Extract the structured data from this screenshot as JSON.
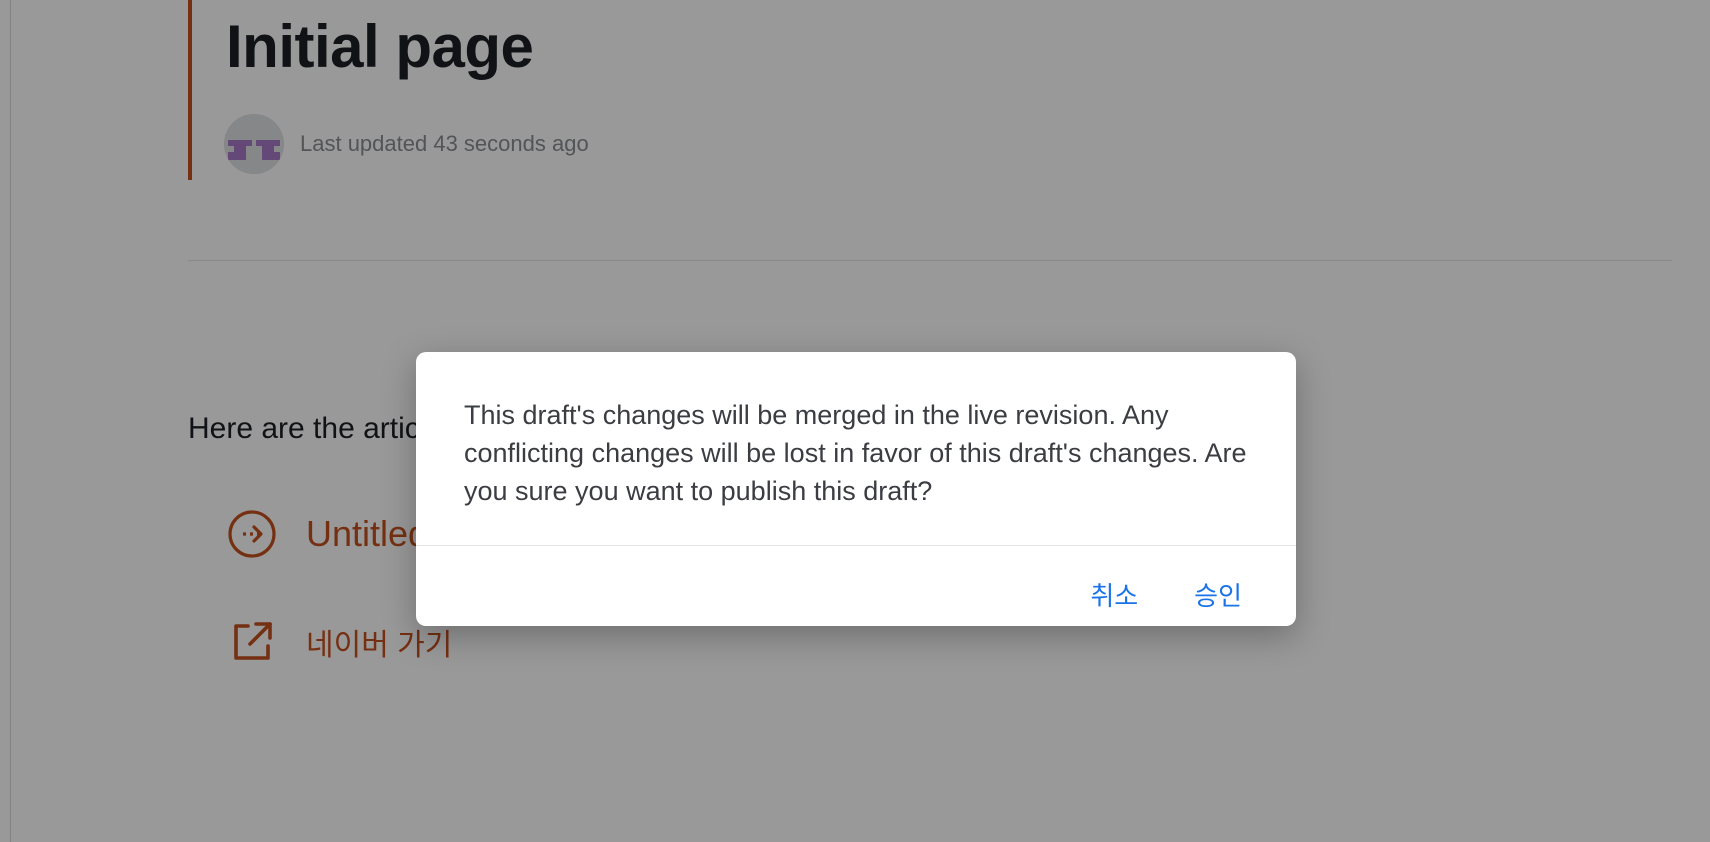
{
  "page": {
    "title": "Initial page",
    "last_updated": "Last updated 43 seconds ago",
    "intro_text": "Here are the articles in this section:",
    "links": [
      {
        "label": "Untitled",
        "icon": "arrow-circle-right-icon"
      },
      {
        "label": "네이버 가기",
        "icon": "external-link-icon"
      }
    ]
  },
  "dialog": {
    "message": "This draft's changes will be merged in the live revision. Any conflicting changes will be lost in favor of this draft's changes. Are you sure you want to publish this draft?",
    "cancel_label": "취소",
    "confirm_label": "승인"
  },
  "colors": {
    "accent": "#c4501f",
    "button_text": "#1a73e8",
    "overlay": "rgba(0,0,0,0.40)"
  }
}
